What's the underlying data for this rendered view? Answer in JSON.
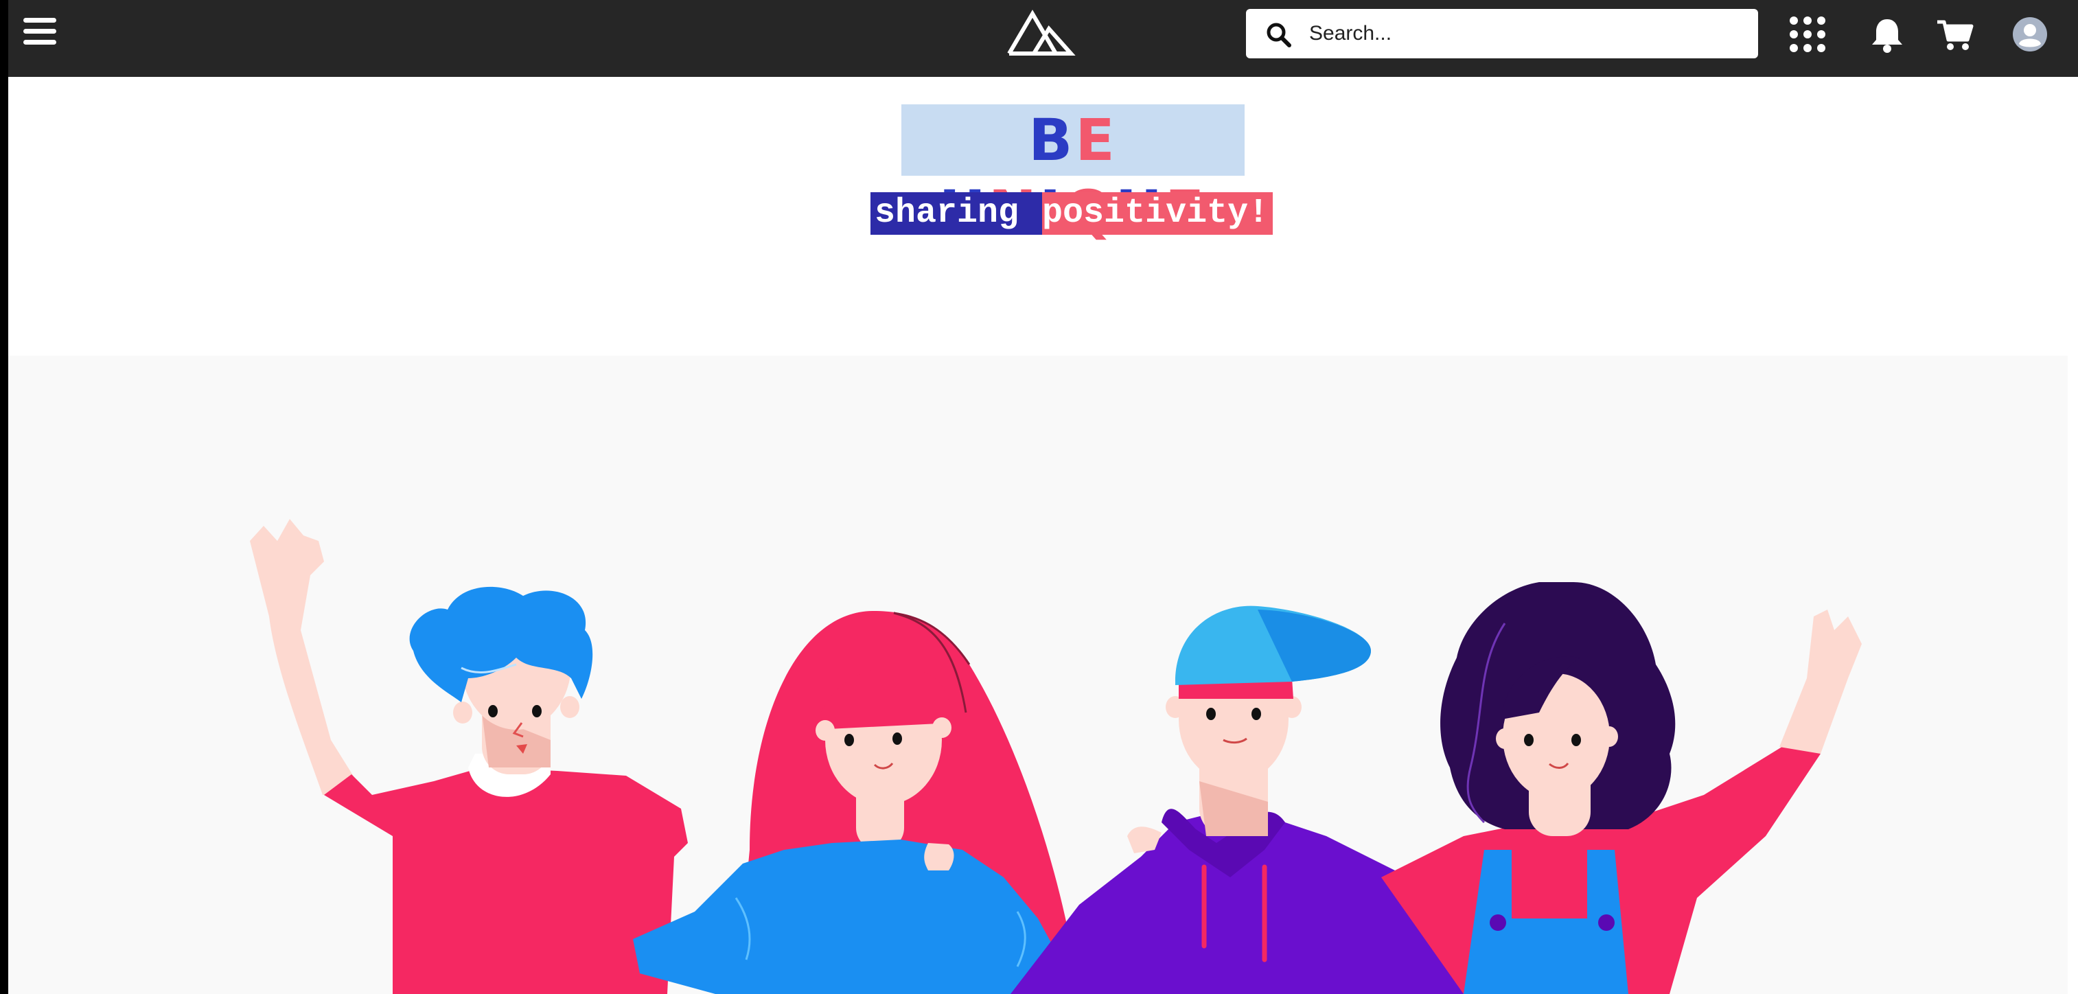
{
  "header": {
    "menu_icon": "hamburger-menu-icon",
    "logo_icon": "mountain-logo-icon",
    "search": {
      "placeholder": "Search...",
      "value": "",
      "icon": "search-icon"
    },
    "actions": [
      {
        "name": "apps",
        "icon": "apps-grid-icon"
      },
      {
        "name": "notifications",
        "icon": "bell-icon"
      },
      {
        "name": "cart",
        "icon": "cart-icon"
      },
      {
        "name": "account",
        "icon": "user-avatar-icon"
      }
    ]
  },
  "hero": {
    "headline_letters": [
      "B",
      "E",
      " ",
      "U",
      "N",
      "I",
      "Q",
      "U",
      "E"
    ],
    "tagline_part1": "sharing ",
    "tagline_part2": "positivity!"
  },
  "colors": {
    "topbar": "#262626",
    "headline_blue": "#2b3cc4",
    "headline_red": "#f2586d",
    "headline_bg": "#c8dcf2",
    "tagline_blue": "#2d2ba8",
    "tagline_red": "#f25a6e"
  },
  "illustration": {
    "subject": "four-friends-illustration"
  }
}
